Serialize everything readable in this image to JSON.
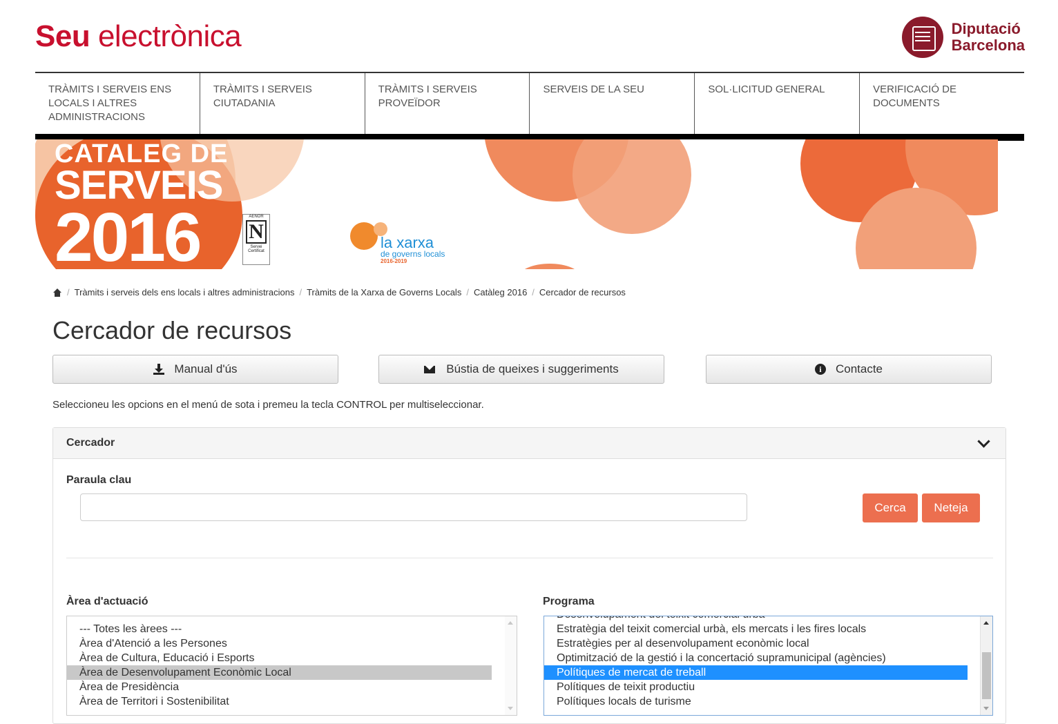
{
  "header": {
    "brand_bold": "Seu",
    "brand_rest": "electrònica",
    "org_line1": "Diputació",
    "org_line2": "Barcelona"
  },
  "nav": [
    {
      "label": "TRÀMITS I SERVEIS ENS LOCALS I ALTRES ADMINISTRACIONS"
    },
    {
      "label": "TRÀMITS I SERVEIS CIUTADANIA"
    },
    {
      "label": "TRÀMITS I SERVEIS PROVEÏDOR"
    },
    {
      "label": "SERVEIS DE LA SEU"
    },
    {
      "label": "SOL·LICITUD GENERAL"
    },
    {
      "label": "VERIFICACIÓ DE DOCUMENTS"
    }
  ],
  "banner": {
    "line1": "CATALEG DE",
    "line2": "SERVEIS",
    "line3": "2016",
    "aenor_label": "AENOR",
    "aenor_sub": "Servei Certificat",
    "xarxa_title": "la xarxa",
    "xarxa_sub": "de governs locals",
    "xarxa_years": "2016-2019",
    "colors": {
      "orange": "#e8632c",
      "light_orange": "#f2a079",
      "peach": "#f6c4a3"
    }
  },
  "breadcrumb": [
    "Tràmits i serveis dels ens locals i altres administracions",
    "Tràmits de la Xarxa de Governs Locals",
    "Catàleg 2016",
    "Cercador de recursos"
  ],
  "page_title": "Cercador de recursos",
  "buttons": {
    "manual": "Manual d'ús",
    "bustia": "Bústia de queixes i suggeriments",
    "contacte": "Contacte"
  },
  "instructions": "Seleccioneu les opcions en el menú de sota i premeu la tecla CONTROL per multiseleccionar.",
  "search_panel": {
    "title": "Cercador",
    "keyword_label": "Paraula clau",
    "keyword_value": "",
    "search_button": "Cerca",
    "clear_button": "Neteja",
    "area_label": "Àrea d'actuació",
    "program_label": "Programa"
  },
  "areas": [
    "--- Totes les àrees ---",
    "Àrea d'Atenció a les Persones",
    "Àrea de Cultura, Educació i Esports",
    "Àrea de Desenvolupament Econòmic Local",
    "Àrea de Presidència",
    "Àrea de Territori i Sostenibilitat"
  ],
  "programs": [
    "Desenvolupament del teixit comercial urbà",
    "Estratègia del teixit comercial urbà, els mercats i les fires locals",
    "Estratègies per al desenvolupament econòmic local",
    "Optimització de la gestió i la concertació supramunicipal (agències)",
    "Polítiques de mercat de treball",
    "Polítiques de teixit productiu",
    "Polítiques locals de turisme"
  ],
  "colors": {
    "brand_red": "#c8102e",
    "diba_maroon": "#8a1a2b",
    "action_orange": "#ec6f4f",
    "selected_blue": "#1e90ff",
    "selected_gray": "#c8c8c8"
  }
}
